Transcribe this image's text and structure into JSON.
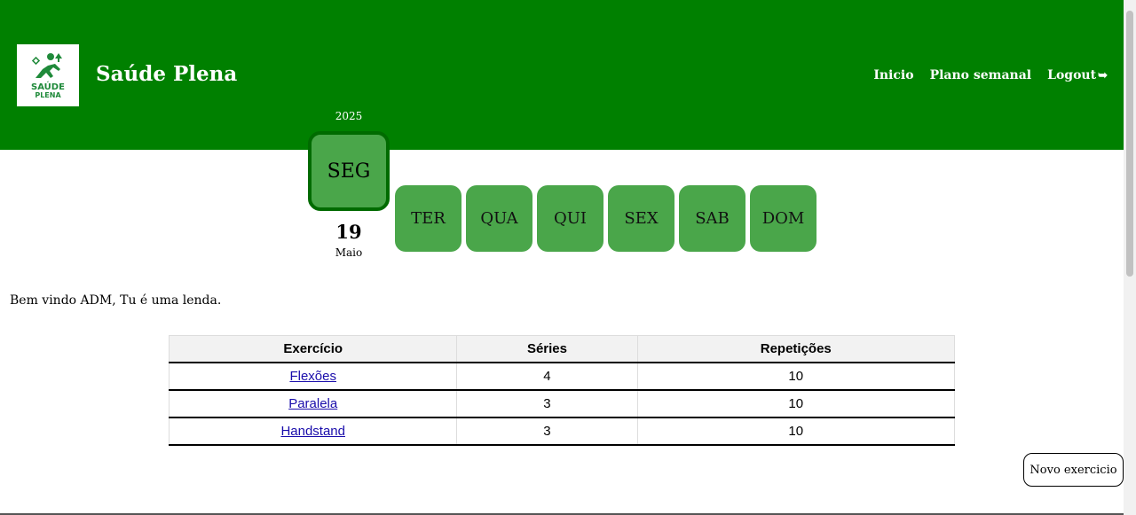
{
  "brand": {
    "logo_line1": "SAÚDE",
    "logo_line2": "PLENA",
    "title": "Saúde Plena"
  },
  "nav": {
    "items": [
      {
        "label": "Inicio"
      },
      {
        "label": "Plano semanal"
      },
      {
        "label": "Logout"
      }
    ],
    "logout_icon": "logout-arrow-icon"
  },
  "calendar": {
    "year": "2025",
    "selected_day": "SEG",
    "date_number": "19",
    "month": "Maio",
    "other_days": [
      "TER",
      "QUA",
      "QUI",
      "SEX",
      "SAB",
      "DOM"
    ]
  },
  "welcome": "Bem vindo ADM, Tu é uma lenda.",
  "table": {
    "headers": [
      "Exercício",
      "Séries",
      "Repetições"
    ],
    "rows": [
      {
        "exercise": "Flexões",
        "series": "4",
        "reps": "10"
      },
      {
        "exercise": "Paralela",
        "series": "3",
        "reps": "10"
      },
      {
        "exercise": "Handstand",
        "series": "3",
        "reps": "10"
      }
    ]
  },
  "actions": {
    "new_exercise": "Novo exercicio"
  },
  "colors": {
    "header_bg": "#008000",
    "day_button": "#4aa64a",
    "active_border": "#006b00"
  }
}
